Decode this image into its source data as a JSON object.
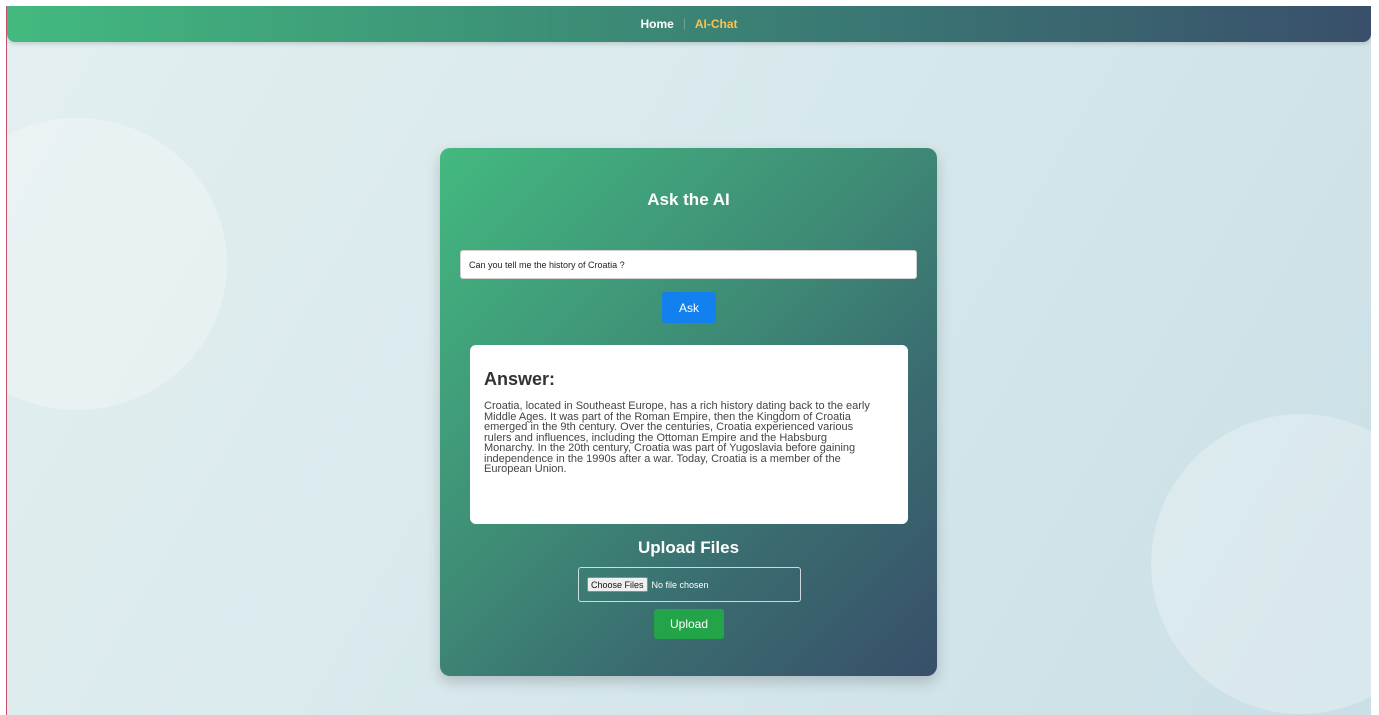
{
  "nav": {
    "home_label": "Home",
    "ai_chat_label": "AI-Chat"
  },
  "ask": {
    "title": "Ask the AI",
    "input_value": "Can you tell me the history of Croatia ?",
    "button_label": "Ask"
  },
  "answer": {
    "heading": "Answer:",
    "text": "Croatia, located in Southeast Europe, has a rich history dating back to the early Middle Ages. It was part of the Roman Empire, then the Kingdom of Croatia emerged in the 9th century. Over the centuries, Croatia experienced various rulers and influences, including the Ottoman Empire and the Habsburg Monarchy. In the 20th century, Croatia was part of Yugoslavia before gaining independence in the 1990s after a war. Today, Croatia is a member of the European Union."
  },
  "upload": {
    "title": "Upload Files",
    "choose_label": "Choose Files",
    "file_status": "No file chosen",
    "button_label": "Upload"
  },
  "colors": {
    "nav_active": "#f6c454",
    "ask_button": "#1280ef",
    "upload_button": "#24a448",
    "card_gradient_start": "#43b97f",
    "card_gradient_end": "#384f69"
  }
}
